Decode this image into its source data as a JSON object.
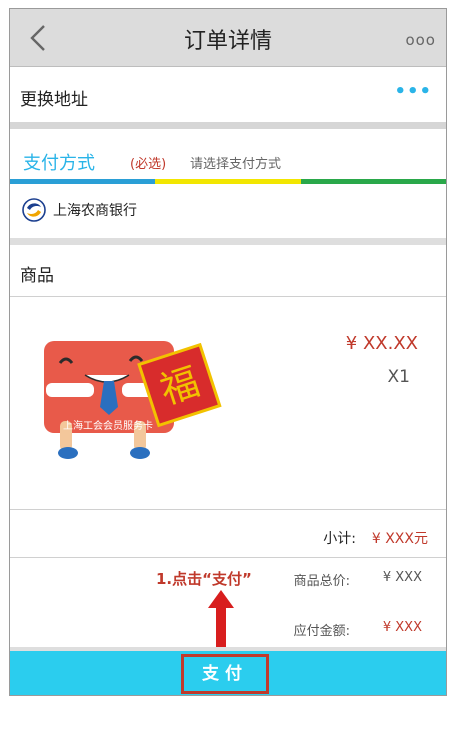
{
  "header": {
    "title": "订单详情",
    "back_icon": "chevron-left-icon",
    "more_icon": "more-icon",
    "more_text": "ooo"
  },
  "address": {
    "label": "更换地址",
    "more_text": "•••"
  },
  "payment": {
    "label": "支付方式",
    "required": "(必选)",
    "hint": "请选择支付方式",
    "stripe_colors": [
      "#2a9fd6",
      "#f2e600",
      "#2aa84a"
    ]
  },
  "bank": {
    "name": "上海农商银行",
    "logo_icon": "bank-logo-icon"
  },
  "goods": {
    "label": "商品",
    "item": {
      "image_caption": "上海工会会员服务卡",
      "image_char": "福",
      "price": "¥ XX.XX",
      "quantity": "X1"
    }
  },
  "subtotal": {
    "label": "小计:",
    "value": "¥ XXX元"
  },
  "summary": {
    "instruction": "1.点击“支付”",
    "total_label": "商品总价:",
    "total_value": "¥ XXX",
    "payable_label": "应付金额:",
    "payable_value": "¥ XXX"
  },
  "bottom": {
    "pay_label": "支付"
  },
  "colors": {
    "accent": "#2ab4e8",
    "bottom_bar": "#2bcdee",
    "price_red": "#c0392b",
    "header_bg": "#dcdcdc"
  }
}
